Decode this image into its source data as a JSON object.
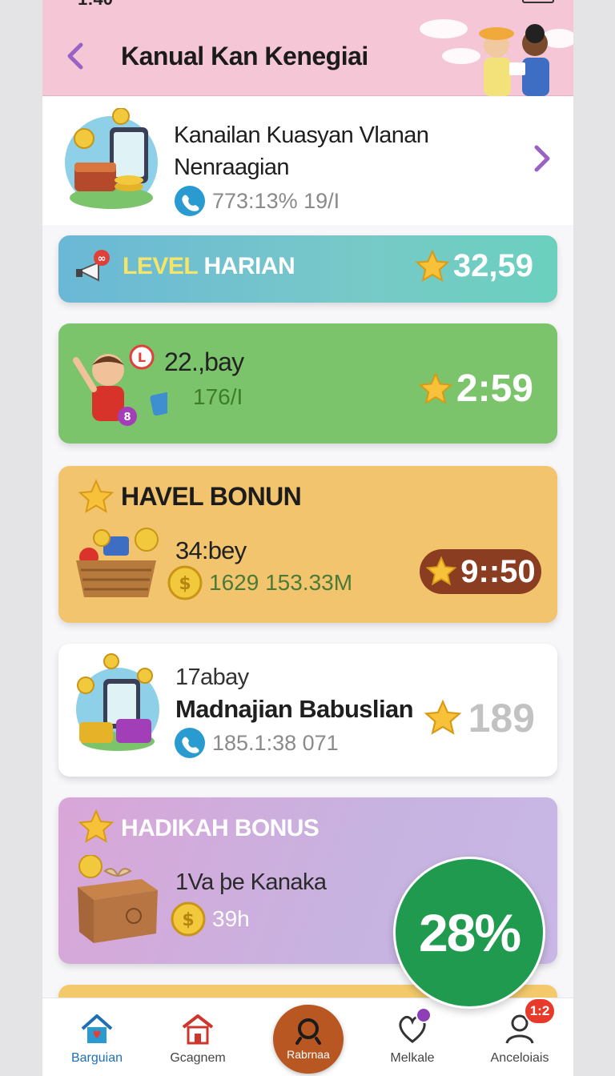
{
  "status": {
    "time": "1:40"
  },
  "header": {
    "title": "Kanual Kan Kenegiai"
  },
  "summary": {
    "title_line1": "Kanailan Kuasyan Vlanan",
    "title_line2": "Nenraagian",
    "subtitle": "773:13% 19/I"
  },
  "level_card": {
    "label_part1": "LEVEL",
    "label_part2": "HARIAN",
    "value": "32,59"
  },
  "green_card": {
    "line1": "22.,bay",
    "line2": "176/I",
    "value": "2:59"
  },
  "havel_card": {
    "heading": "HAVEL BONUN",
    "line1": "34:bey",
    "line2": "1629 153.33M",
    "value": "9::50"
  },
  "white_card": {
    "line0": "17abay",
    "line1": "Madnajian Babuslian",
    "line2": "185.1:38 071",
    "value": "189"
  },
  "hadiah_card": {
    "heading": "HADIKAH BONUS",
    "line1": "1Va þe Kanaka",
    "line2": "39h"
  },
  "progress_badge": {
    "text": "28%",
    "value_percent": 28
  },
  "tabbar": {
    "tabs": [
      {
        "label": "Barguian",
        "icon": "home-icon"
      },
      {
        "label": "Gcagnem",
        "icon": "shop-icon"
      },
      {
        "label": "Rabrnaa",
        "icon": "search-icon"
      },
      {
        "label": "Melkale",
        "icon": "heart-icon"
      },
      {
        "label": "Anceloiais",
        "icon": "profile-icon"
      }
    ],
    "notification_badge": "1:2"
  },
  "colors": {
    "header_bg": "#f5c6d6",
    "level_card": "#6ab8d6",
    "green_card": "#7cc46b",
    "havel_card": "#f2c46e",
    "hadiah_card": "#d9a6d8",
    "progress_green": "#1f9a4f",
    "accent_purple": "#9a62c4"
  }
}
